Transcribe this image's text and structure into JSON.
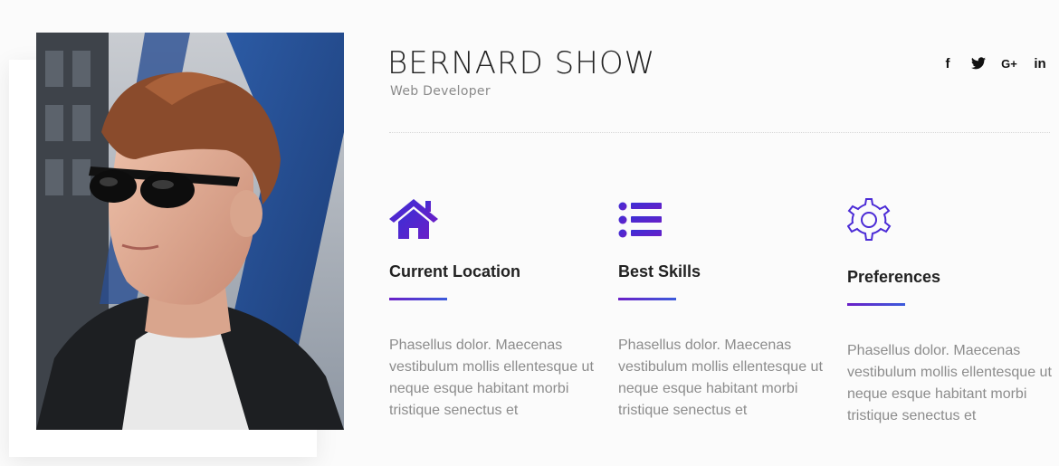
{
  "profile": {
    "name": "BERNARD SHOW",
    "role": "Web Developer"
  },
  "social": [
    {
      "label": "f",
      "icon": "facebook-icon"
    },
    {
      "label": "t",
      "icon": "twitter-icon"
    },
    {
      "label": "G+",
      "icon": "google-plus-icon"
    },
    {
      "label": "in",
      "icon": "linkedin-icon"
    }
  ],
  "features": [
    {
      "icon": "house-icon",
      "title": "Current Location",
      "text": "Phasellus dolor. Maecenas vestibulum mollis ellentesque ut neque esque habitant morbi tristique senectus et"
    },
    {
      "icon": "list-icon",
      "title": "Best Skills",
      "text": "Phasellus dolor. Maecenas vestibulum mollis ellentesque ut neque esque habitant morbi tristique senectus et"
    },
    {
      "icon": "gear-icon",
      "title": "Preferences",
      "text": "Phasellus dolor. Maecenas vestibulum mollis ellentesque ut neque esque habitant morbi tristique senectus et"
    }
  ],
  "colors": {
    "accent_start": "#6a1fc7",
    "accent_end": "#3b5bdb",
    "icon_primary": "#4b2bd6"
  }
}
